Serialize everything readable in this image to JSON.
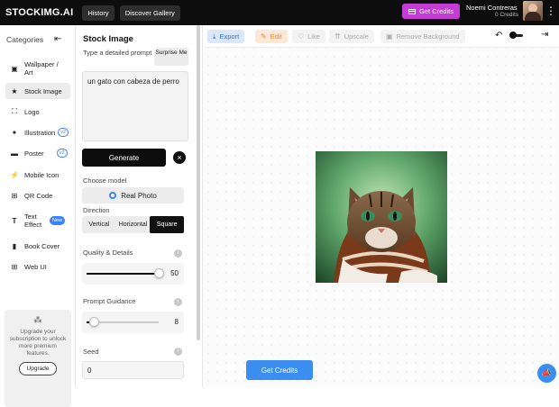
{
  "header": {
    "logo": "STOCKIMG.AI",
    "nav": [
      "History",
      "Discover Gallery"
    ],
    "get_credits": "Get Credits",
    "user_name": "Noemi Contreras",
    "user_credits": "0 Credits"
  },
  "sidebar": {
    "title": "Categories",
    "items": [
      {
        "label": "Wallpaper / Art",
        "icon": "image-icon"
      },
      {
        "label": "Stock Image",
        "icon": "star-icon"
      },
      {
        "label": "Logo",
        "icon": "logo-icon"
      },
      {
        "label": "Illustration",
        "icon": "sparkle-icon",
        "badge": "v2"
      },
      {
        "label": "Poster",
        "icon": "poster-icon",
        "badge": "v2"
      },
      {
        "label": "Mobile Icon",
        "icon": "bolt-icon"
      },
      {
        "label": "QR Code",
        "icon": "qr-icon"
      },
      {
        "label": "Text Effect",
        "icon": "text-icon",
        "badge": "New"
      },
      {
        "label": "Book Cover",
        "icon": "book-icon"
      },
      {
        "label": "Web UI",
        "icon": "grid-icon"
      }
    ],
    "upgrade_text": "Upgrade your subscription to unlock more premium features.",
    "upgrade_button": "Upgrade"
  },
  "panel": {
    "title": "Stock Image",
    "prompt_label": "Type a detailed prompt",
    "surprise": "Surprise Me",
    "prompt_value": "un gato con cabeza de perro",
    "generate": "Generate",
    "model_label": "Choose model",
    "model_value": "Real Photo",
    "direction_label": "Direction",
    "directions": [
      "Vertical",
      "Horizontal",
      "Square"
    ],
    "direction_selected": "Square",
    "quality_label": "Quality & Details",
    "quality_value": "50",
    "quality_fraction": 1.0,
    "guidance_label": "Prompt Guidance",
    "guidance_value": "8",
    "guidance_fraction": 0.1,
    "seed_label": "Seed",
    "seed_value": "0"
  },
  "toolbar": {
    "export": "Export",
    "edit": "Edit",
    "like": "Like",
    "upscale": "Upscale",
    "remove_bg": "Remove Background"
  },
  "main": {
    "get_credits": "Get Credits"
  },
  "colors": {
    "accent_blue": "#3b8df0",
    "credits_purple": "#c53bd6"
  }
}
